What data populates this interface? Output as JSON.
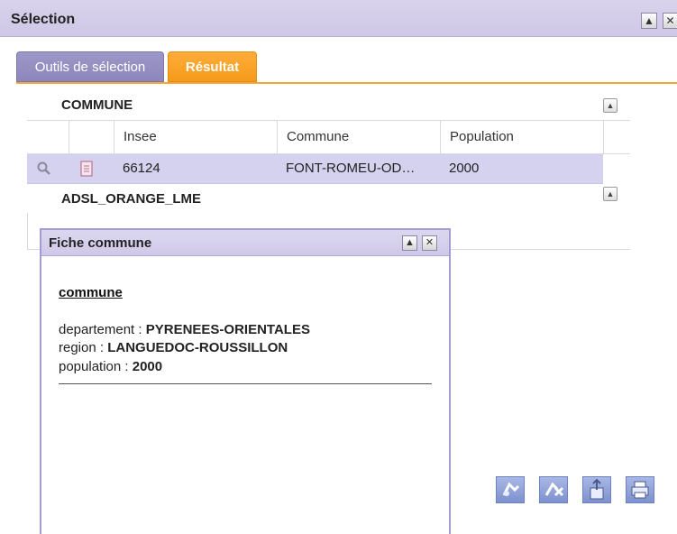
{
  "window": {
    "title": "Sélection",
    "minimize_symbol": "▲",
    "close_symbol": "✕"
  },
  "tabs": [
    {
      "label": "Outils de sélection",
      "active": false
    },
    {
      "label": "Résultat",
      "active": true
    }
  ],
  "sections": [
    {
      "title": "COMMUNE",
      "columns": [
        "Insee",
        "Commune",
        "Population"
      ],
      "rows": [
        {
          "insee": "66124",
          "commune": "FONT-ROMEU-OD…",
          "population": "2000"
        }
      ]
    },
    {
      "title": "ADSL_ORANGE_LME"
    }
  ],
  "popup": {
    "title": "Fiche commune",
    "heading": "commune",
    "fields": [
      {
        "label": "departement : ",
        "value": "PYRENEES-ORIENTALES"
      },
      {
        "label": "region : ",
        "value": "LANGUEDOC-ROUSSILLON"
      },
      {
        "label": "population : ",
        "value": "2000"
      }
    ]
  },
  "actions": [
    {
      "icon": "zoom-selection-icon"
    },
    {
      "icon": "clear-selection-icon"
    },
    {
      "icon": "export-icon"
    },
    {
      "icon": "print-icon"
    }
  ],
  "colors": {
    "tab_active": "#f59a1a",
    "tab_inactive": "#8c86bb",
    "selected_row": "#d4d2ee",
    "title_bar": "#d8d2ec"
  }
}
